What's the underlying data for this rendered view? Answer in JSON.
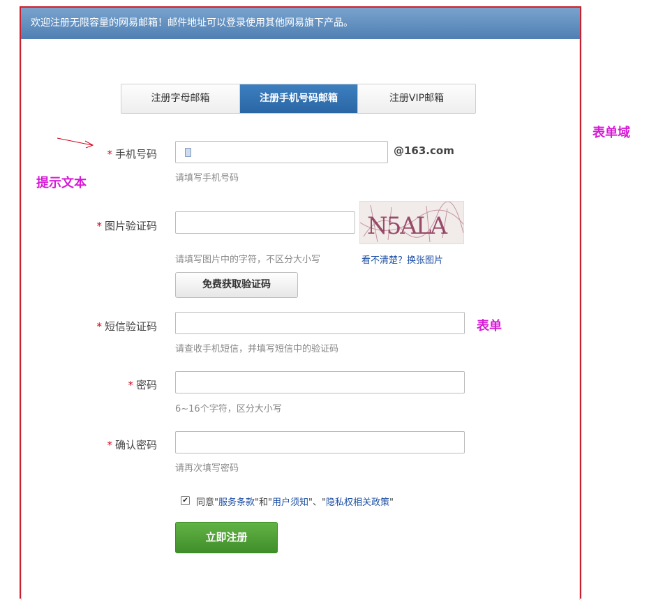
{
  "banner": {
    "text": "欢迎注册无限容量的网易邮箱！邮件地址可以登录使用其他网易旗下产品。"
  },
  "tabs": [
    {
      "label": "注册字母邮箱",
      "active": false
    },
    {
      "label": "注册手机号码邮箱",
      "active": true
    },
    {
      "label": "注册VIP邮箱",
      "active": false
    }
  ],
  "fields": {
    "phone": {
      "label": "手机号码",
      "value": "",
      "suffix": "@163.com",
      "hint": "请填写手机号码"
    },
    "captcha": {
      "label": "图片验证码",
      "value": "",
      "hint": "请填写图片中的字符，不区分大小写",
      "refresh_link": "看不清楚？换张图片",
      "image_text": "N5ALA"
    },
    "get_code_button": "免费获取验证码",
    "sms": {
      "label": "短信验证码",
      "value": "",
      "hint": "请查收手机短信，并填写短信中的验证码"
    },
    "password": {
      "label": "密码",
      "value": "",
      "hint": "6~16个字符，区分大小写"
    },
    "confirm": {
      "label": "确认密码",
      "value": "",
      "hint": "请再次填写密码"
    }
  },
  "required_mark": "*",
  "agreement": {
    "checked": true,
    "prefix": "同意",
    "q1": "\"",
    "terms": "服务条款",
    "and": "\"和\"",
    "notice": "用户须知",
    "sep": "\"、\"",
    "privacy": "隐私权相关政策",
    "end": "\""
  },
  "submit_button": "立即注册",
  "annotations": {
    "form_domain": "表单域",
    "hint_text": "提示文本",
    "form": "表单"
  },
  "colors": {
    "required": "#d0021b",
    "annotation": "#d61ad6",
    "border_frame": "#c8202e",
    "submit": "#4a9e33",
    "tab_active": "#2f6fae"
  }
}
